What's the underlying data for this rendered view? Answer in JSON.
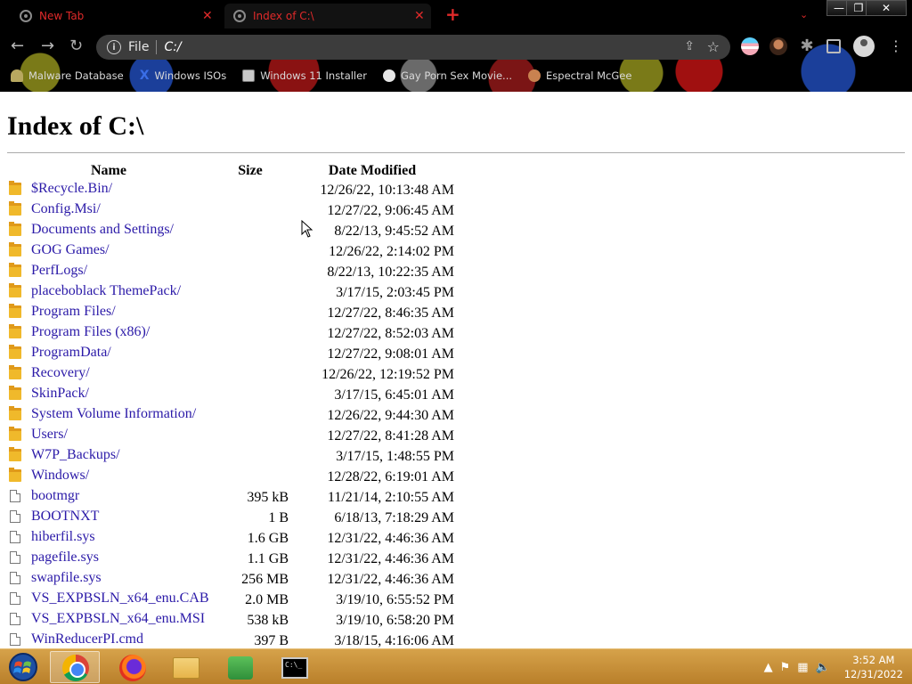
{
  "tabs": [
    {
      "label": "New Tab",
      "active": false
    },
    {
      "label": "Index of C:\\",
      "active": true
    }
  ],
  "toolbar": {
    "scheme": "File",
    "url": "C:/"
  },
  "bookmarks": [
    {
      "label": "Malware Database",
      "icon": "user-icon"
    },
    {
      "label": "Windows ISOs",
      "icon": "x-icon"
    },
    {
      "label": "Windows 11 Installer",
      "icon": "image-icon"
    },
    {
      "label": "Gay Porn Sex Movie...",
      "icon": "site-icon"
    },
    {
      "label": "Espectral McGee",
      "icon": "avatar-icon"
    }
  ],
  "page": {
    "title": "Index of C:\\",
    "columns": {
      "name": "Name",
      "size": "Size",
      "date": "Date Modified"
    },
    "rows": [
      {
        "type": "folder",
        "name": "$Recycle.Bin/",
        "size": "",
        "date": "12/26/22, 10:13:48 AM"
      },
      {
        "type": "folder",
        "name": "Config.Msi/",
        "size": "",
        "date": "12/27/22, 9:06:45 AM"
      },
      {
        "type": "folder",
        "name": "Documents and Settings/",
        "size": "",
        "date": "8/22/13, 9:45:52 AM"
      },
      {
        "type": "folder",
        "name": "GOG Games/",
        "size": "",
        "date": "12/26/22, 2:14:02 PM"
      },
      {
        "type": "folder",
        "name": "PerfLogs/",
        "size": "",
        "date": "8/22/13, 10:22:35 AM"
      },
      {
        "type": "folder",
        "name": "placeboblack ThemePack/",
        "size": "",
        "date": "3/17/15, 2:03:45 PM"
      },
      {
        "type": "folder",
        "name": "Program Files/",
        "size": "",
        "date": "12/27/22, 8:46:35 AM"
      },
      {
        "type": "folder",
        "name": "Program Files (x86)/",
        "size": "",
        "date": "12/27/22, 8:52:03 AM"
      },
      {
        "type": "folder",
        "name": "ProgramData/",
        "size": "",
        "date": "12/27/22, 9:08:01 AM"
      },
      {
        "type": "folder",
        "name": "Recovery/",
        "size": "",
        "date": "12/26/22, 12:19:52 PM"
      },
      {
        "type": "folder",
        "name": "SkinPack/",
        "size": "",
        "date": "3/17/15, 6:45:01 AM"
      },
      {
        "type": "folder",
        "name": "System Volume Information/",
        "size": "",
        "date": "12/26/22, 9:44:30 AM"
      },
      {
        "type": "folder",
        "name": "Users/",
        "size": "",
        "date": "12/27/22, 8:41:28 AM"
      },
      {
        "type": "folder",
        "name": "W7P_Backups/",
        "size": "",
        "date": "3/17/15, 1:48:55 PM"
      },
      {
        "type": "folder",
        "name": "Windows/",
        "size": "",
        "date": "12/28/22, 6:19:01 AM"
      },
      {
        "type": "file",
        "name": "bootmgr",
        "size": "395 kB",
        "date": "11/21/14, 2:10:55 AM"
      },
      {
        "type": "file",
        "name": "BOOTNXT",
        "size": "1 B",
        "date": "6/18/13, 7:18:29 AM"
      },
      {
        "type": "file",
        "name": "hiberfil.sys",
        "size": "1.6 GB",
        "date": "12/31/22, 4:46:36 AM"
      },
      {
        "type": "file",
        "name": "pagefile.sys",
        "size": "1.1 GB",
        "date": "12/31/22, 4:46:36 AM"
      },
      {
        "type": "file",
        "name": "swapfile.sys",
        "size": "256 MB",
        "date": "12/31/22, 4:46:36 AM"
      },
      {
        "type": "file",
        "name": "VS_EXPBSLN_x64_enu.CAB",
        "size": "2.0 MB",
        "date": "3/19/10, 6:55:52 PM"
      },
      {
        "type": "file",
        "name": "VS_EXPBSLN_x64_enu.MSI",
        "size": "538 kB",
        "date": "3/19/10, 6:58:20 PM"
      },
      {
        "type": "file",
        "name": "WinReducerPI.cmd",
        "size": "397 B",
        "date": "3/18/15, 4:16:06 AM"
      }
    ]
  },
  "taskbar": {
    "apps": [
      "chrome",
      "firefox",
      "file-explorer",
      "network-tool",
      "command-prompt"
    ],
    "active_app": "chrome",
    "clock_time": "3:52 AM",
    "clock_date": "12/31/2022"
  },
  "colors": {
    "link": "#2b1aa8",
    "tab_text": "#e02a2a",
    "taskbar": "#c98f36"
  }
}
